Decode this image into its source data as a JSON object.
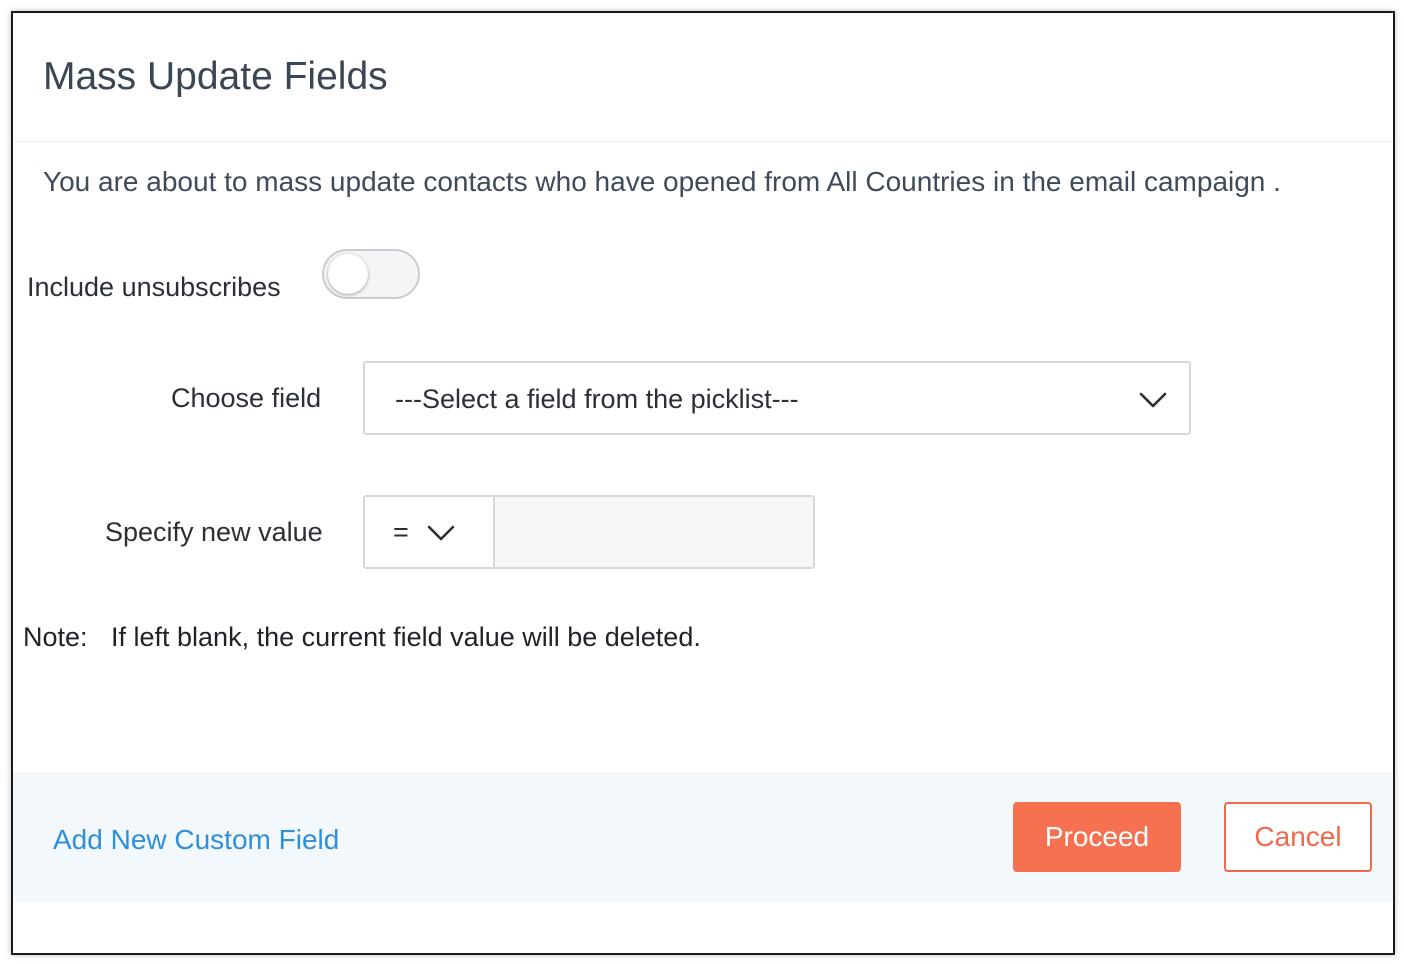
{
  "dialog": {
    "title": "Mass Update Fields",
    "intro": "You are about to mass update contacts who have opened from All Countries in the email campaign ."
  },
  "unsubscribes": {
    "label": "Include unsubscribes",
    "enabled": false
  },
  "choose_field": {
    "label": "Choose field",
    "selected": "---Select a field from the picklist---"
  },
  "new_value": {
    "label": "Specify new value",
    "operator": "=",
    "value": ""
  },
  "note": {
    "label": "Note:",
    "text": "If left blank, the current field value will be deleted."
  },
  "footer": {
    "add_custom_field": "Add New Custom Field",
    "proceed_label": "Proceed",
    "cancel_label": "Cancel"
  },
  "colors": {
    "accent": "#f6714f",
    "link": "#2f8fd8",
    "footer_bg": "#f2f8fc"
  }
}
